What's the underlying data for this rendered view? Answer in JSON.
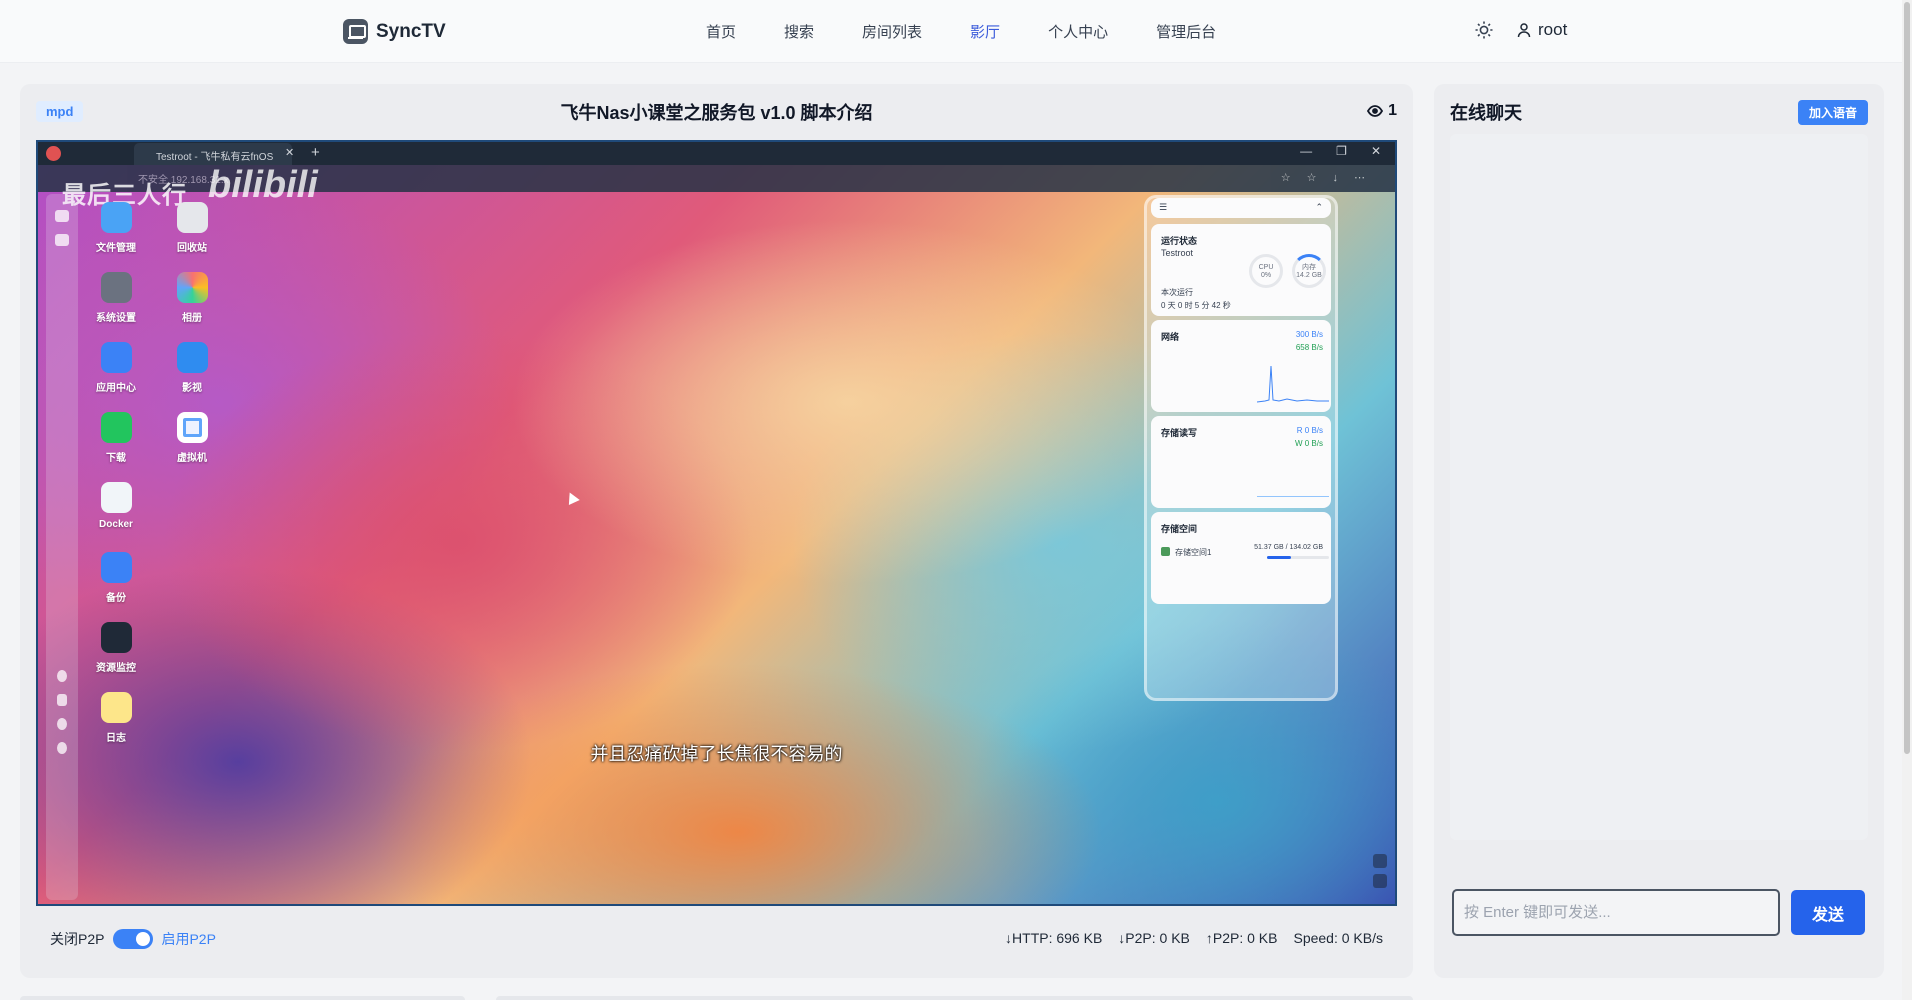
{
  "app": {
    "name": "SyncTV"
  },
  "nav": {
    "items": [
      {
        "label": "首页",
        "active": false
      },
      {
        "label": "搜索",
        "active": false
      },
      {
        "label": "房间列表",
        "active": false
      },
      {
        "label": "影厅",
        "active": true
      },
      {
        "label": "个人中心",
        "active": false
      },
      {
        "label": "管理后台",
        "active": false
      }
    ],
    "theme_icon": "sun-icon",
    "user": {
      "name": "root",
      "icon": "user-icon"
    }
  },
  "player": {
    "format_badge": "mpd",
    "title": "飞牛Nas小课堂之服务包 v1.0 脚本介绍",
    "viewer_count": "1",
    "video_frame": {
      "browser_tab": "Testroot - 飞牛私有云fnOS",
      "address": "不安全    192.168.31.x",
      "watermark": "最后三人行",
      "watermark_logo": "bilibili",
      "subtitle": "并且忍痛砍掉了长焦很不容易的",
      "desktop_apps": [
        {
          "label": "文件管理",
          "color": "#4aa3f5"
        },
        {
          "label": "回收站",
          "color": "#e5e7eb"
        },
        {
          "label": "系统设置",
          "color": "#6b7280"
        },
        {
          "label": "相册",
          "color": "#f8fafc"
        },
        {
          "label": "应用中心",
          "color": "#3b82f6"
        },
        {
          "label": "影视",
          "color": "#2f8cf0"
        },
        {
          "label": "下载",
          "color": "#22c55e"
        },
        {
          "label": "虚拟机",
          "color": "#eef2ff"
        },
        {
          "label": "Docker",
          "color": "#f1f5f9"
        },
        {
          "label": "备份",
          "color": "#3b82f6"
        },
        {
          "label": "资源监控",
          "color": "#1f2937"
        },
        {
          "label": "日志",
          "color": "#fde68a"
        }
      ],
      "widgets": {
        "status": {
          "title": "运行状态",
          "host": "Testroot",
          "cpu_label": "CPU",
          "cpu_value": "0%",
          "mem_label": "内存",
          "mem_value": "14.2 GB",
          "uptime_label": "本次运行",
          "uptime_value": "0 天 0 时 5 分 42 秒"
        },
        "network": {
          "title": "网络",
          "up": "300 B/s",
          "down": "658 B/s"
        },
        "disk_io": {
          "title": "存储读写",
          "read": "R  0 B/s",
          "write": "W  0 B/s"
        },
        "storage": {
          "title": "存储空间",
          "volume": "存储空间1",
          "usage": "51.37 GB / 134.02 GB",
          "fraction": 0.38
        }
      }
    },
    "p2p": {
      "off_label": "关闭P2P",
      "on_label": "启用P2P",
      "enabled": true
    },
    "stats": {
      "http": "↓HTTP: 696 KB",
      "p2p_down": "↓P2P: 0 KB",
      "p2p_up": "↑P2P: 0 KB",
      "speed": "Speed: 0 KB/s"
    }
  },
  "chat": {
    "title": "在线聊天",
    "voice_button": "加入语音",
    "input_placeholder": "按 Enter 键即可发送...",
    "send_button": "发送"
  },
  "colors": {
    "accent": "#3b82f6",
    "nav_active": "#3b5bdb",
    "send": "#2563eb"
  }
}
